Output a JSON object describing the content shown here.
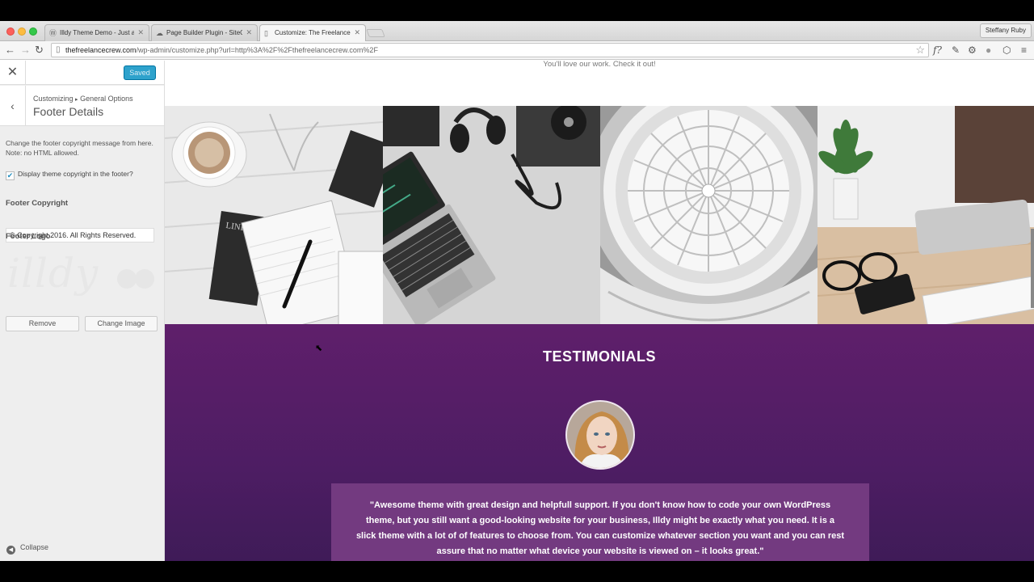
{
  "browser": {
    "tabs": [
      {
        "title": "Illdy Theme Demo - Just a",
        "favicon": "wordpress-icon"
      },
      {
        "title": "Page Builder Plugin - SiteO",
        "favicon": "cloud-icon"
      },
      {
        "title": "Customize: The Freelance",
        "favicon": "page-icon"
      }
    ],
    "user": "Steffany Ruby",
    "url_host": "thefreelancecrew.com",
    "url_path": "/wp-admin/customize.php?url=http%3A%2F%2Fthefreelancecrew.com%2F"
  },
  "customizer": {
    "saved_label": "Saved",
    "breadcrumb_root": "Customizing",
    "breadcrumb_section": "General Options",
    "panel_title": "Footer Details",
    "description": "Change the footer copyright message from here. Note: no HTML allowed.",
    "checkbox_label": "Display theme copyright in the footer?",
    "checkbox_checked": true,
    "footer_copyright_label": "Footer Copyright",
    "footer_copyright_value": "© Copyright 2016. All Rights Reserved.",
    "footer_logo_label": "Footer Logo",
    "logo_text": "illdy",
    "remove_label": "Remove",
    "change_image_label": "Change Image",
    "collapse_label": "Collapse"
  },
  "preview": {
    "tagline": "You'll love our work. Check it out!",
    "testimonials_title": "TESTIMONIALS",
    "quote": "\"Awesome theme with great design and helpfull support. If you don't know how to code your own WordPress theme, but you still want a good-looking website for your business, Illdy might be exactly what you need. It is a slick theme with a lot of of features to choose from. You can customize whatever section you want and you can rest assure that no matter what device your website is viewed on – it looks great.\"",
    "accent_color": "#5f1f6b"
  }
}
